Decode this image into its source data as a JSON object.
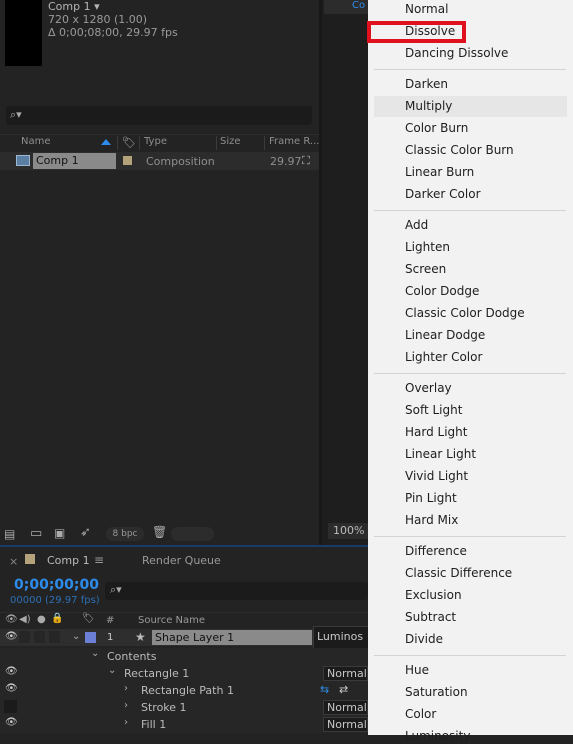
{
  "project": {
    "comp_title": "Comp 1 ▾",
    "dimensions": "720 x 1280 (1.00)",
    "duration": "Δ 0;00;08;00, 29.97 fps",
    "columns": {
      "name": "Name",
      "type": "Type",
      "size": "Size",
      "frame_rate": "Frame R..."
    },
    "item": {
      "name": "Comp 1",
      "type": "Composition",
      "fps": "29.97"
    },
    "bpc": "8 bpc"
  },
  "viewer": {
    "tab": "Co",
    "zoom": "100%"
  },
  "timeline": {
    "tab_comp": "Comp 1",
    "tab_render": "Render Queue",
    "timecode": "0;00;00;00",
    "frames": "00000 (29.97 fps)",
    "col_num": "#",
    "col_source": "Source Name",
    "layer": {
      "num": "1",
      "name": "Shape Layer 1",
      "mode": "Luminos"
    },
    "contents": "Contents",
    "rectangle": "Rectangle 1",
    "rect_path": "Rectangle Path 1",
    "stroke": "Stroke 1",
    "fill": "Fill 1",
    "mode_normal": "Normal"
  },
  "blend_menu": {
    "groups": [
      [
        "Normal",
        "Dissolve",
        "Dancing Dissolve"
      ],
      [
        "Darken",
        "Multiply",
        "Color Burn",
        "Classic Color Burn",
        "Linear Burn",
        "Darker Color"
      ],
      [
        "Add",
        "Lighten",
        "Screen",
        "Color Dodge",
        "Classic Color Dodge",
        "Linear Dodge",
        "Lighter Color"
      ],
      [
        "Overlay",
        "Soft Light",
        "Hard Light",
        "Linear Light",
        "Vivid Light",
        "Pin Light",
        "Hard Mix"
      ],
      [
        "Difference",
        "Classic Difference",
        "Exclusion",
        "Subtract",
        "Divide"
      ],
      [
        "Hue",
        "Saturation",
        "Color",
        "Luminosity"
      ]
    ],
    "highlighted": "Dissolve",
    "hovered": "Multiply"
  },
  "colors": {
    "highlight_red": "#e0101f",
    "accent_blue": "#2d8ceb",
    "label_tan": "#b3a27a",
    "label_blue": "#6b7fd6"
  }
}
